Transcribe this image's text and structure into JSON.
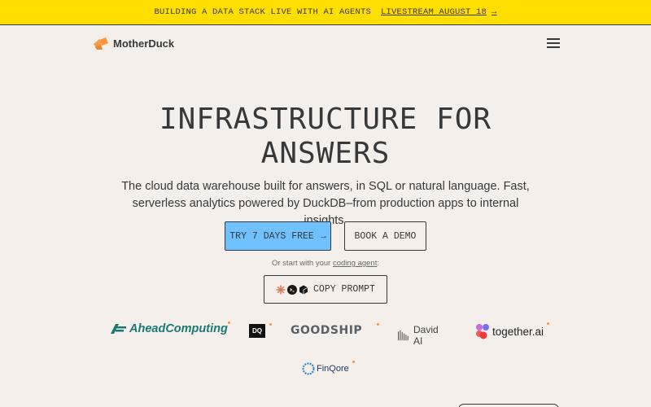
{
  "banner": {
    "message": "BUILDING A DATA STACK LIVE WITH AI AGENTS",
    "link_label": "LIVESTREAM AUGUST 18",
    "arrow": "→"
  },
  "header": {
    "logo_text": "MotherDuck",
    "menu_icon": "hamburger-icon"
  },
  "hero": {
    "title_line1": "INFRASTRUCTURE FOR",
    "title_line2": "ANSWERS",
    "subtitle_line1": "The cloud data warehouse built for answers, in SQL or natural language. Fast,",
    "subtitle_line2": "serverless analytics powered by DuckDB–from production apps to internal insights.",
    "cta_primary": "TRY 7 DAYS FREE",
    "cta_primary_arrow": "→",
    "cta_secondary": "BOOK A DEMO",
    "agent_prefix": "Or start with your ",
    "agent_link": "coding agent",
    "agent_suffix": ":",
    "copy_prompt": "COPY PROMPT"
  },
  "customers": [
    {
      "name": "AheadComputing"
    },
    {
      "name": "DQ"
    },
    {
      "name": "GOODSHIP"
    },
    {
      "name": "David AI"
    },
    {
      "name": "together.ai"
    },
    {
      "name": "FinQore"
    }
  ],
  "colors": {
    "background": "#F4EFEA",
    "banner": "#FFDE00",
    "primary_button": "#6FC2FF",
    "text": "#383838",
    "accent_dot": "#FF9538"
  }
}
